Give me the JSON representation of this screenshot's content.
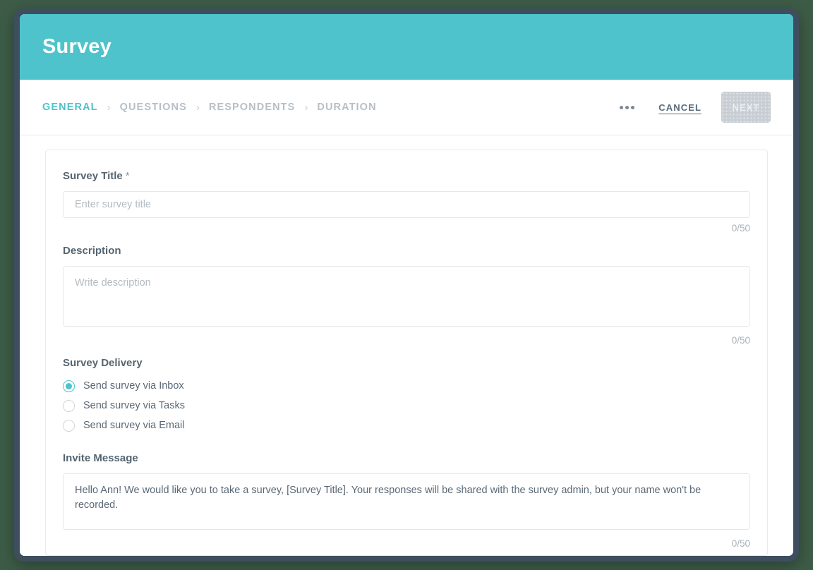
{
  "header": {
    "title": "Survey"
  },
  "nav": {
    "steps": [
      {
        "label": "GENERAL",
        "active": true
      },
      {
        "label": "QUESTIONS",
        "active": false
      },
      {
        "label": "RESPONDENTS",
        "active": false
      },
      {
        "label": "DURATION",
        "active": false
      }
    ],
    "separator": "›",
    "kebab_icon": "more-options-icon",
    "cancel_label": "CANCEL",
    "next_label": "NEXT"
  },
  "form": {
    "survey_title": {
      "label": "Survey Title",
      "required_mark": "*",
      "placeholder": "Enter survey title",
      "value": "",
      "counter": "0/50"
    },
    "description": {
      "label": "Description",
      "placeholder": "Write description",
      "value": "",
      "counter": "0/50"
    },
    "survey_delivery": {
      "label": "Survey Delivery",
      "options": [
        {
          "label": "Send survey via Inbox",
          "selected": true
        },
        {
          "label": "Send survey via Tasks",
          "selected": false
        },
        {
          "label": "Send survey via Email",
          "selected": false
        }
      ]
    },
    "invite_message": {
      "label": "Invite Message",
      "value": "Hello Ann! We would like you to take a survey, [Survey Title]. Your responses will be shared with the survey admin, but your name won't be recorded.",
      "counter": "0/50"
    }
  },
  "colors": {
    "accent_teal": "#4ec3cb",
    "label_text": "#56646f",
    "muted_text": "#a9b2ba",
    "desktop_background": "#3d5c47",
    "window_frame": "#3f4e5f"
  }
}
